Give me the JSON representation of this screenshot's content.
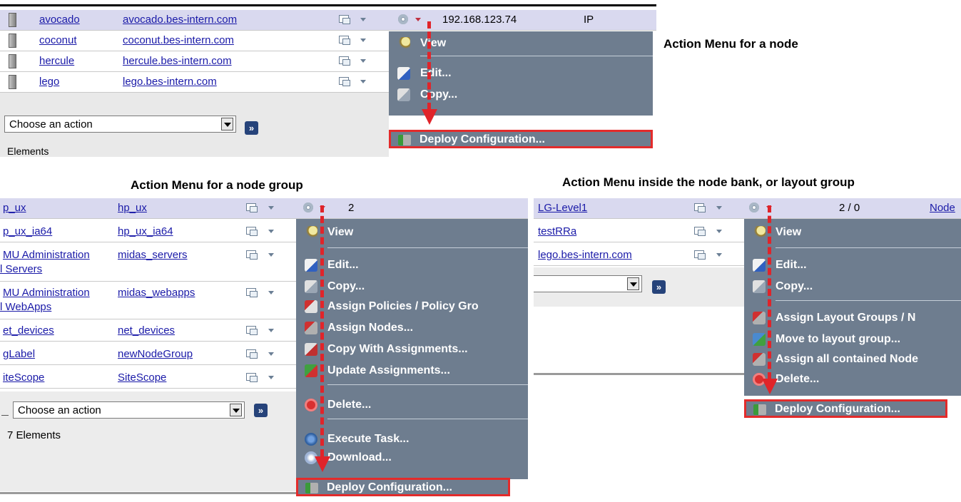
{
  "captions": {
    "node": "Action Menu for a node",
    "node_group": "Action Menu for a node group",
    "layout_group": "Action Menu inside the node bank, or layout group"
  },
  "panel1": {
    "rows": [
      {
        "name": "avocado",
        "host": "avocado.bes-intern.com"
      },
      {
        "name": "coconut",
        "host": "coconut.bes-intern.com"
      },
      {
        "name": "hercule",
        "host": "hercule.bes-intern.com"
      },
      {
        "name": "lego",
        "host": "lego.bes-intern.com"
      }
    ],
    "ip": "192.168.123.74",
    "ip_type": "IP",
    "select_value": "Choose an action",
    "go_label": "»",
    "footer_text": "Elements",
    "menu": {
      "view": "View",
      "edit": "Edit...",
      "copy": "Copy...",
      "deploy": "Deploy Configuration..."
    }
  },
  "panel2": {
    "rows": [
      {
        "name": "p_ux",
        "group": "hp_ux"
      },
      {
        "name": "p_ux_ia64",
        "group": "hp_ux_ia64"
      },
      {
        "name": "MU Administration",
        "name2": "l Servers",
        "group": "midas_servers"
      },
      {
        "name": "MU Administration",
        "name2": "l WebApps",
        "group": "midas_webapps"
      },
      {
        "name": "et_devices",
        "group": "net_devices"
      },
      {
        "name": "gLabel",
        "group": "newNodeGroup"
      },
      {
        "name": "iteScope",
        "group": "SiteScope"
      }
    ],
    "count": "2",
    "select_value": "Choose an action",
    "go_label": "»",
    "footer_text": "7 Elements",
    "menu": {
      "view": "View",
      "edit": "Edit...",
      "copy": "Copy...",
      "assign_policies": "Assign Policies / Policy Gro",
      "assign_nodes": "Assign Nodes...",
      "copy_with": "Copy With Assignments...",
      "update": "Update Assignments...",
      "delete": "Delete...",
      "execute": "Execute Task...",
      "download": "Download...",
      "deploy": "Deploy Configuration..."
    }
  },
  "panel3": {
    "rows": [
      {
        "name": "LG-Level1"
      },
      {
        "name": "testRRa"
      },
      {
        "name": "lego.bes-intern.com"
      }
    ],
    "count": "2 / 0",
    "node_link": "Node",
    "go_label": "»",
    "menu": {
      "view": "View",
      "edit": "Edit...",
      "copy": "Copy...",
      "assign_layout": "Assign Layout Groups / N",
      "move": "Move to layout group...",
      "assign_all": "Assign all contained Node",
      "delete": "Delete...",
      "deploy": "Deploy Configuration..."
    }
  },
  "colors": {
    "menu_bg": "#6e7d8f",
    "highlight_row": "#d9d9ef",
    "arrow_red": "#e0242a",
    "link_blue": "#1a1aa8"
  }
}
